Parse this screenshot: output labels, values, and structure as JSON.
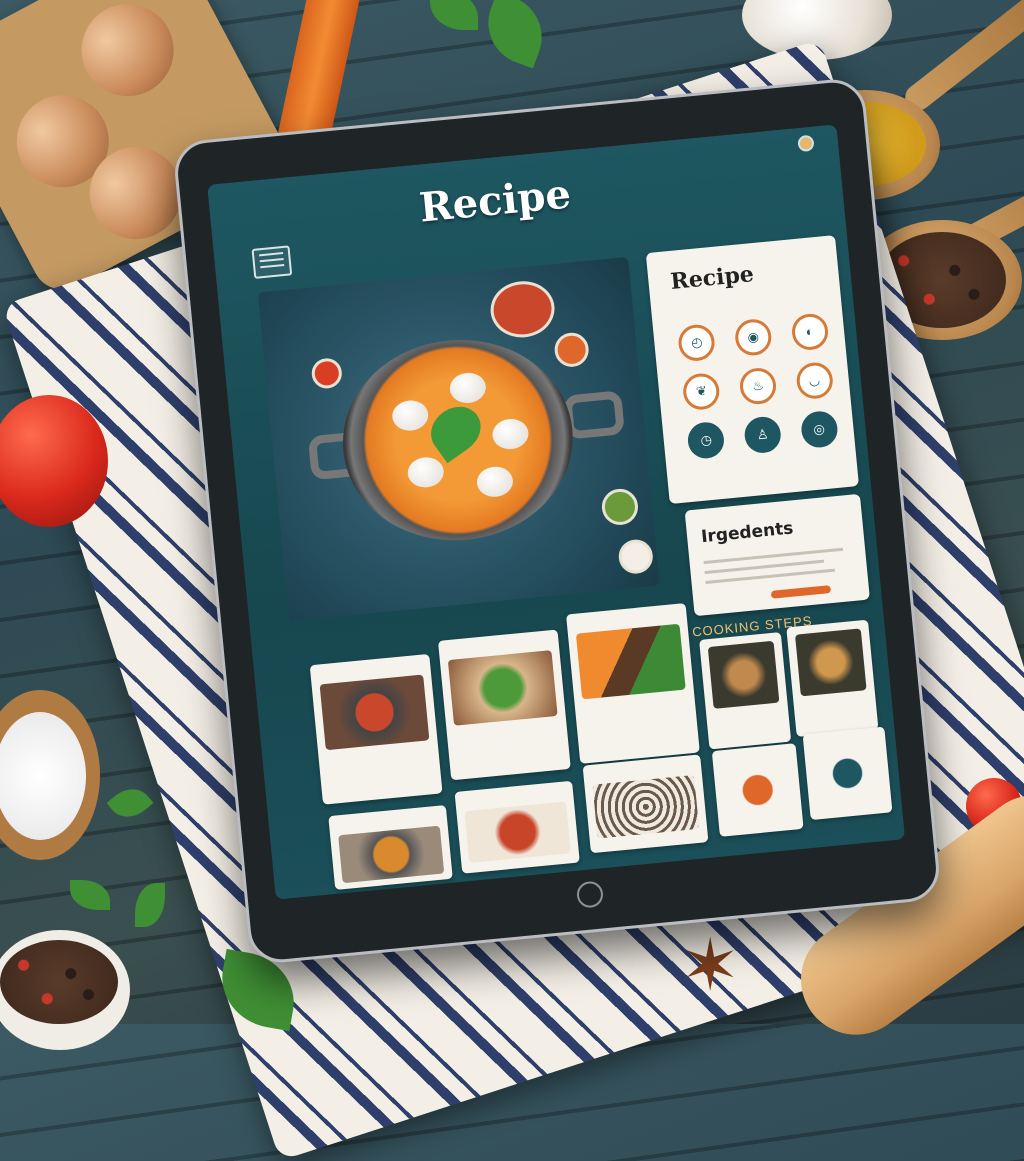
{
  "app": {
    "title": "Recipe",
    "status_left": "",
    "status_center": "",
    "header_caption": ""
  },
  "recipe_card": {
    "title": "Recipe",
    "subtitle": "",
    "icons": [
      {
        "icon": "clock-icon",
        "label": ""
      },
      {
        "icon": "pot-icon",
        "label": ""
      },
      {
        "icon": "knife-icon",
        "label": ""
      },
      {
        "icon": "leaf-icon",
        "label": ""
      },
      {
        "icon": "fire-icon",
        "label": ""
      },
      {
        "icon": "bowl-icon",
        "label": ""
      },
      {
        "icon": "timer-icon",
        "label": ""
      },
      {
        "icon": "chef-icon",
        "label": ""
      },
      {
        "icon": "plate-icon",
        "label": ""
      }
    ]
  },
  "ingredients": {
    "title": "Irgedents"
  },
  "cooking_steps": {
    "title": "COOKING STEPS"
  },
  "tiles": [
    {
      "label": "",
      "caption": ""
    },
    {
      "label": "",
      "caption": ""
    },
    {
      "label": "",
      "caption": ""
    },
    {
      "label": "",
      "caption": ""
    },
    {
      "label": "",
      "caption": ""
    },
    {
      "label": "",
      "caption": ""
    },
    {
      "label": "",
      "caption": ""
    },
    {
      "label": "",
      "caption": ""
    },
    {
      "label": "",
      "caption": ""
    },
    {
      "label": "",
      "caption": ""
    }
  ],
  "colors": {
    "screen_bg": "#1e5761",
    "accent_orange": "#e0672a",
    "card_bg": "#f6f3ec"
  }
}
